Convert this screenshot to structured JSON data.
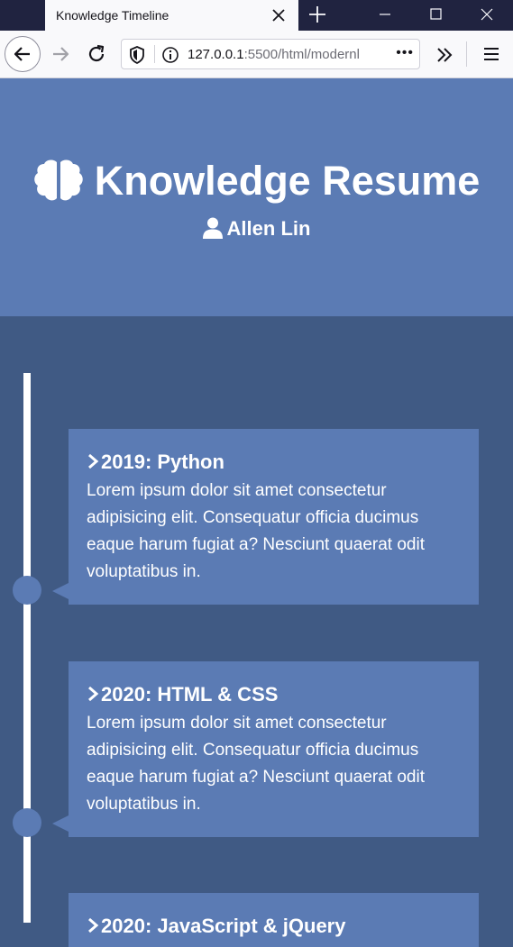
{
  "browser": {
    "tab_title": "Knowledge Timeline",
    "url_host": "127.0.0.1",
    "url_path": ":5500/html/modernl",
    "url_more": "•••"
  },
  "header": {
    "title": "Knowledge Resume",
    "author": "Allen Lin"
  },
  "timeline": [
    {
      "heading": "2019: Python",
      "body": "Lorem ipsum dolor sit amet consectetur adipisicing elit. Consequatur officia ducimus eaque harum fugiat a? Nesciunt quaerat odit voluptatibus in."
    },
    {
      "heading": "2020: HTML & CSS",
      "body": "Lorem ipsum dolor sit amet consectetur adipisicing elit. Consequatur officia ducimus eaque harum fugiat a? Nesciunt quaerat odit voluptatibus in."
    },
    {
      "heading": "2020: JavaScript & jQuery",
      "body": ""
    }
  ],
  "colors": {
    "hero": "#5b7bb4",
    "background": "#405a84",
    "line": "#ffffff"
  }
}
